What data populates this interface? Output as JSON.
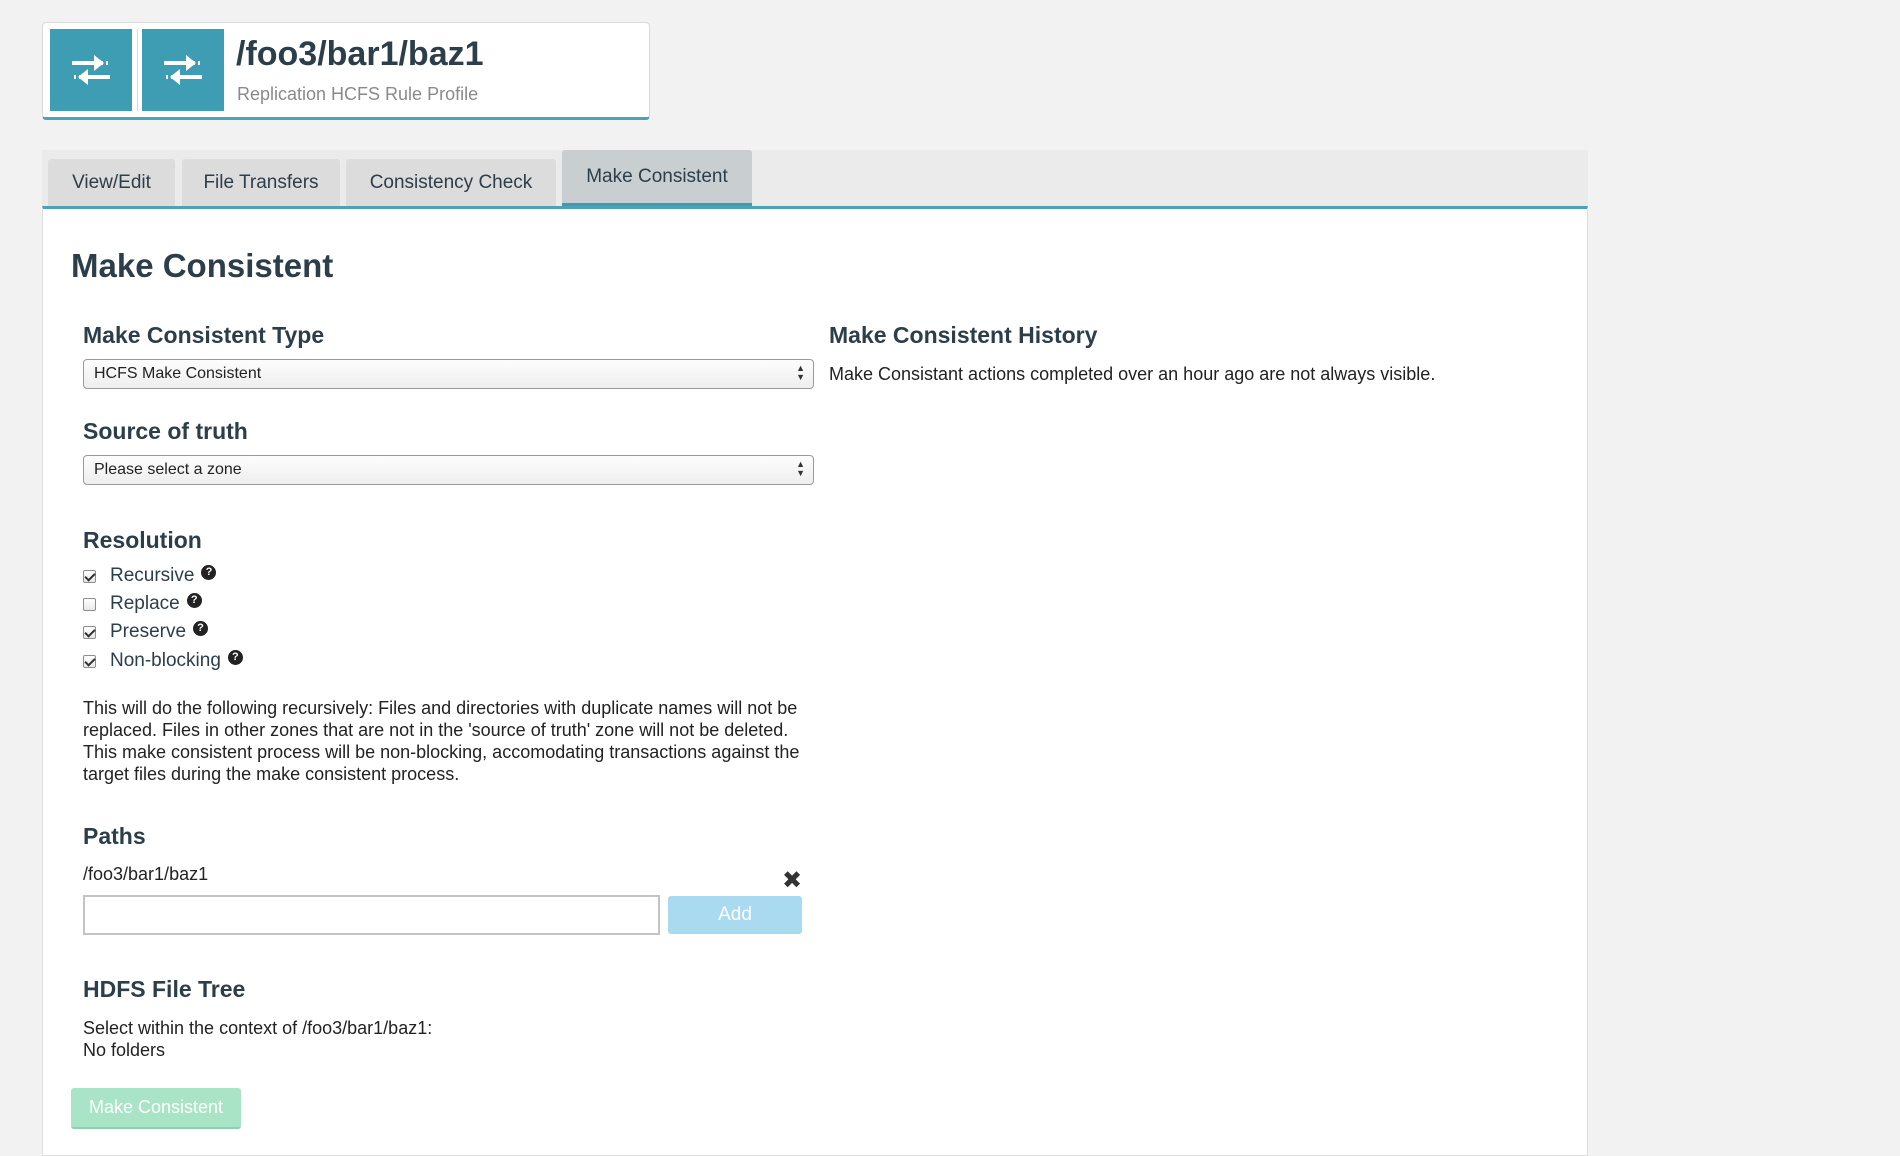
{
  "header": {
    "title": "/foo3/bar1/baz1",
    "subtitle": "Replication HCFS Rule Profile",
    "icon": "replication-arrows-icon",
    "accent_color": "#3f9db3"
  },
  "tabs": [
    {
      "label": "View/Edit",
      "active": false
    },
    {
      "label": "File Transfers",
      "active": false
    },
    {
      "label": "Consistency Check",
      "active": false
    },
    {
      "label": "Make Consistent",
      "active": true
    }
  ],
  "main": {
    "title": "Make Consistent",
    "type_section": {
      "label": "Make Consistent Type",
      "selected": "HCFS Make Consistent"
    },
    "source_section": {
      "label": "Source of truth",
      "selected": "Please select a zone"
    },
    "resolution": {
      "label": "Resolution",
      "options": [
        {
          "label": "Recursive",
          "checked": true
        },
        {
          "label": "Replace",
          "checked": false
        },
        {
          "label": "Preserve",
          "checked": true
        },
        {
          "label": "Non-blocking",
          "checked": true
        }
      ],
      "description": "This will do the following recursively: Files and directories with duplicate names will not be replaced. Files in other zones that are not in the 'source of truth' zone will not be deleted. This make consistent process will be non-blocking, accomodating transactions against the target files during the make consistent process."
    },
    "paths": {
      "label": "Paths",
      "items": [
        "/foo3/bar1/baz1"
      ],
      "input_value": "",
      "add_label": "Add"
    },
    "file_tree": {
      "label": "HDFS File Tree",
      "context": "Select within the context of /foo3/bar1/baz1:",
      "empty": "No folders"
    },
    "submit_label": "Make Consistent",
    "history": {
      "label": "Make Consistent History",
      "note": "Make Consistant actions completed over an hour ago are not always visible."
    }
  }
}
